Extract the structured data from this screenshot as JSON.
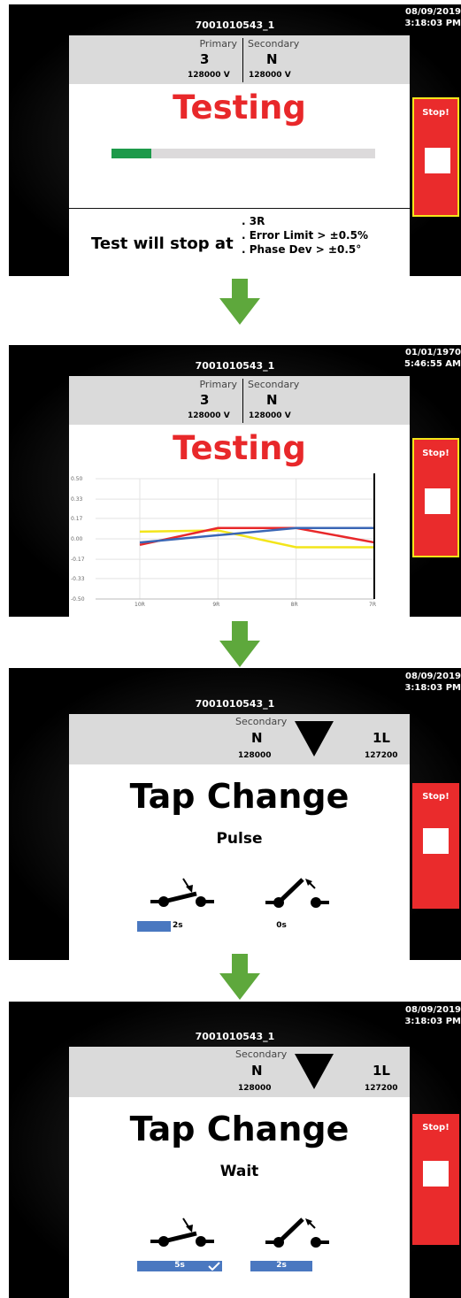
{
  "colors": {
    "stop_red": "#ea2b2c",
    "stop_border": "#f3e51a",
    "arrow": "#5ea83c",
    "progress_fill": "#1d9a4a",
    "bar_blue": "#4a78c0"
  },
  "screens": {
    "s1": {
      "device_id": "7001010543_1",
      "date": "08/09/2019",
      "time": "3:18:03 PM",
      "primary_label": "Primary",
      "secondary_label": "Secondary",
      "primary_tap": "3",
      "secondary_tap": "N",
      "primary_voltage": "128000 V",
      "secondary_voltage": "128000 V",
      "status": "Testing",
      "progress": 0.15,
      "stop_title": "Test will stop at",
      "conditions": [
        ". 3R",
        ". Error Limit > ±0.5%",
        ". Phase Dev > ±0.5°"
      ],
      "stop_label": "Stop!"
    },
    "s2": {
      "device_id": "7001010543_1",
      "date": "01/01/1970",
      "time": "5:46:55 AM",
      "primary_label": "Primary",
      "secondary_label": "Secondary",
      "primary_tap": "3",
      "secondary_tap": "N",
      "primary_voltage": "128000 V",
      "secondary_voltage": "128000 V",
      "status": "Testing",
      "stop_label": "Stop!"
    },
    "s3": {
      "device_id": "7001010543_1",
      "date": "08/09/2019",
      "time": "3:18:03 PM",
      "secondary_label": "Secondary",
      "secondary_tap": "N",
      "secondary_value": "128000",
      "target_tap": "1L",
      "target_value": "127200",
      "title": "Tap Change",
      "subtitle": "Pulse",
      "left_time": "2s",
      "right_time": "0s",
      "left_fill": 0.4,
      "right_fill": 0,
      "stop_label": "Stop!"
    },
    "s4": {
      "device_id": "7001010543_1",
      "date": "08/09/2019",
      "time": "3:18:03 PM",
      "secondary_label": "Secondary",
      "secondary_tap": "N",
      "secondary_value": "128000",
      "target_tap": "1L",
      "target_value": "127200",
      "title": "Tap Change",
      "subtitle": "Wait",
      "left_time": "5s",
      "right_time": "2s",
      "left_fill": 1,
      "right_fill": 1,
      "stop_label": "Stop!"
    }
  },
  "chart_data": {
    "type": "line",
    "x": [
      "10R",
      "9R",
      "8R",
      "7R"
    ],
    "yticks": [
      "0.50",
      "0.33",
      "0.17",
      "0.00",
      "-0.17",
      "-0.33",
      "-0.50"
    ],
    "ylim": [
      -0.5,
      0.5
    ],
    "grid": true,
    "marker_x": "7R",
    "series": [
      {
        "color": "#f3e51a",
        "values": [
          0.06,
          0.07,
          -0.07,
          -0.07
        ]
      },
      {
        "color": "#e8282a",
        "values": [
          -0.05,
          0.09,
          0.09,
          -0.03
        ]
      },
      {
        "color": "#3a66b5",
        "values": [
          -0.03,
          0.03,
          0.09,
          0.09
        ]
      }
    ]
  }
}
